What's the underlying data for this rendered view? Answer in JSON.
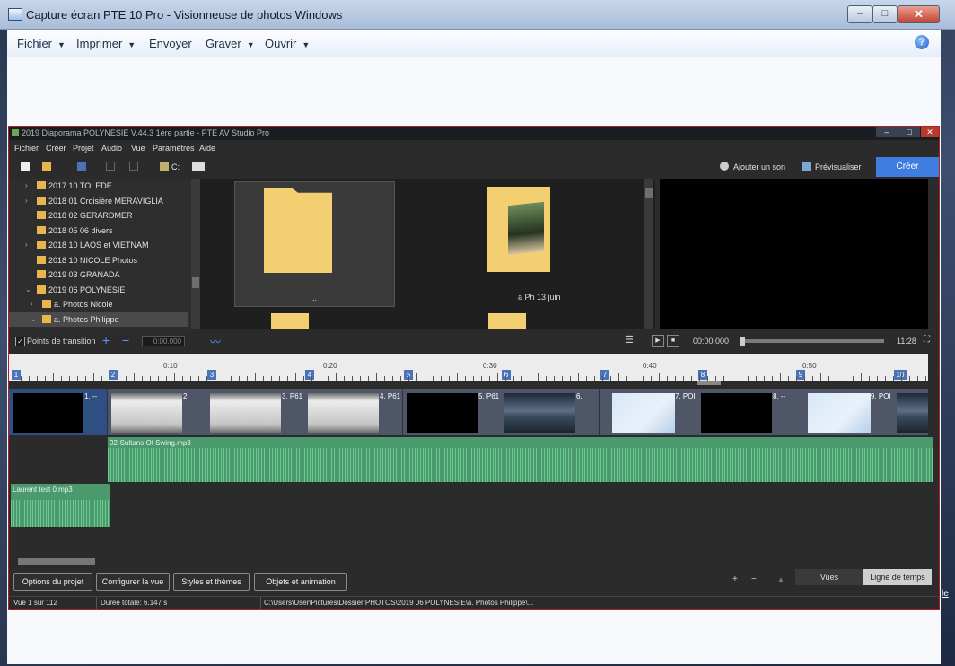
{
  "viewer": {
    "title": "Capture écran PTE 10 Pro - Visionneuse de photos Windows",
    "controls": {
      "minimize": "–",
      "maximize": "□",
      "close": "✕"
    },
    "menu": [
      {
        "label": "Fichier",
        "dropdown": true
      },
      {
        "label": "Imprimer",
        "dropdown": true
      },
      {
        "label": "Envoyer",
        "dropdown": false
      },
      {
        "label": "Graver",
        "dropdown": true
      },
      {
        "label": "Ouvrir",
        "dropdown": true
      }
    ],
    "help_icon": "help-icon"
  },
  "pte": {
    "title": "2019 Diaporama POLYNESIE V.44.3  1ère partie - PTE AV Studio Pro",
    "menu": [
      "Fichier",
      "Créer",
      "Projet",
      "Audio",
      "Vue",
      "Paramètres",
      "Aide"
    ],
    "toolbar": {
      "drive_label": "C:",
      "add_sound": "Ajouter un son",
      "preview": "Prévisualiser",
      "create": "Créer"
    },
    "tree": [
      {
        "label": "2017 10 TOLEDE",
        "expandable": true
      },
      {
        "label": "2018 01 Croisière MERAVIGLIA",
        "expandable": true
      },
      {
        "label": "2018 02 GERARDMER",
        "expandable": false
      },
      {
        "label": "2018 05 06 divers",
        "expandable": false
      },
      {
        "label": "2018 10 LAOS et VIETNAM",
        "expandable": true
      },
      {
        "label": "2018 10 NICOLE Photos",
        "expandable": false
      },
      {
        "label": "2019 03 GRANADA",
        "expandable": false
      },
      {
        "label": "2019 06 POLYNESIE",
        "expandable": true,
        "expanded": true
      },
      {
        "label": "a. Photos Nicole",
        "expandable": true,
        "child": true
      },
      {
        "label": "a. Photos Philippe",
        "expandable": true,
        "expanded": true,
        "child": true,
        "selected": true
      }
    ],
    "files": [
      {
        "label": ".."
      },
      {
        "label": "a Ph 13 juin"
      }
    ],
    "transitions": {
      "checkbox_label": "Points de transition",
      "checked": true,
      "time_field": "0:00.000",
      "position": "00:00.000",
      "duration": "11:28"
    },
    "ruler": {
      "labels": [
        "0:10",
        "0:20",
        "0:30",
        "0:40",
        "0:50"
      ],
      "markers": [
        "1",
        "2",
        "3",
        "4",
        "5",
        "6",
        "7",
        "8",
        "9",
        "10"
      ]
    },
    "slides": [
      {
        "caption": "1. --",
        "type": "black",
        "selected": true
      },
      {
        "caption": "2.",
        "type": "grey"
      },
      {
        "caption": "3. P61",
        "type": "grey"
      },
      {
        "caption": "4. P61",
        "type": "grey"
      },
      {
        "caption": "5. P61",
        "type": "black"
      },
      {
        "caption": "6.",
        "type": "sea"
      },
      {
        "caption": "7. POI",
        "type": "map"
      },
      {
        "caption": "8. --",
        "type": "black"
      },
      {
        "caption": "9. POI",
        "type": "map"
      },
      {
        "caption": "",
        "type": "sea"
      }
    ],
    "audio": [
      {
        "name": "02-Sultans Of Swing.mp3"
      },
      {
        "name": "Laurent test 0.mp3"
      }
    ],
    "buttons": [
      "Options du projet",
      "Configurer la vue",
      "Styles et thèmes",
      "Objets et animation"
    ],
    "tabs": [
      {
        "label": "Vues",
        "active": false
      },
      {
        "label": "Ligne de temps",
        "active": true
      }
    ],
    "status": {
      "slide": "Vue 1 sur 112",
      "duration": "Durée totale: 6.147 s",
      "path": "C:\\Users\\User\\Pictures\\Dossier PHOTOS\\2019 06 POLYNESIE\\a. Photos Philippe\\..."
    },
    "colors": {
      "accent": "#3f7ee0",
      "audio": "#4a9a6e",
      "folder": "#f4cf72",
      "border": "#b02028"
    }
  },
  "side_text": "le"
}
